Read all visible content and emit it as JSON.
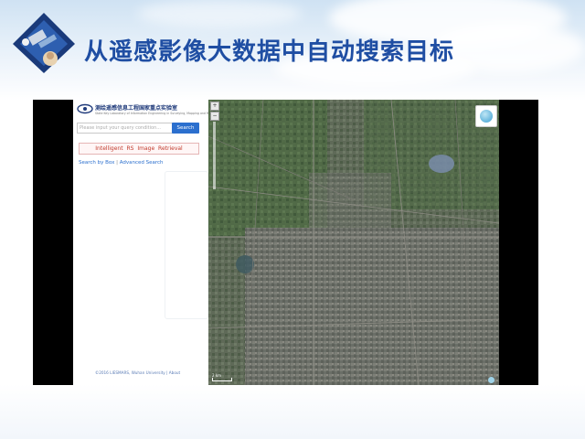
{
  "slide": {
    "title": "从遥感影像大数据中自动搜索目标"
  },
  "app": {
    "brand_name": "测绘遥感信息工程国家重点实验室",
    "brand_sub": "State Key Laboratory of Information Engineering in Surveying, Mapping and Remote Sensing",
    "search": {
      "placeholder": "Please input your query condition...",
      "button_label": "Search"
    },
    "tab_label": "Intelligent RS Image Retrieval",
    "links": {
      "search_by_box": "Search by Box",
      "separator": "|",
      "advanced_search": "Advanced Search"
    },
    "footer": "©2016 LIESMARS, Wuhan University | About"
  },
  "map": {
    "zoom_in_label": "+",
    "zoom_out_label": "−",
    "scale_label": "2 km",
    "globe_icon": "globe-icon"
  },
  "colors": {
    "title": "#1f4ea3",
    "search_button": "#2b6fce",
    "tab_text": "#c0392b",
    "link": "#2b6fce"
  }
}
